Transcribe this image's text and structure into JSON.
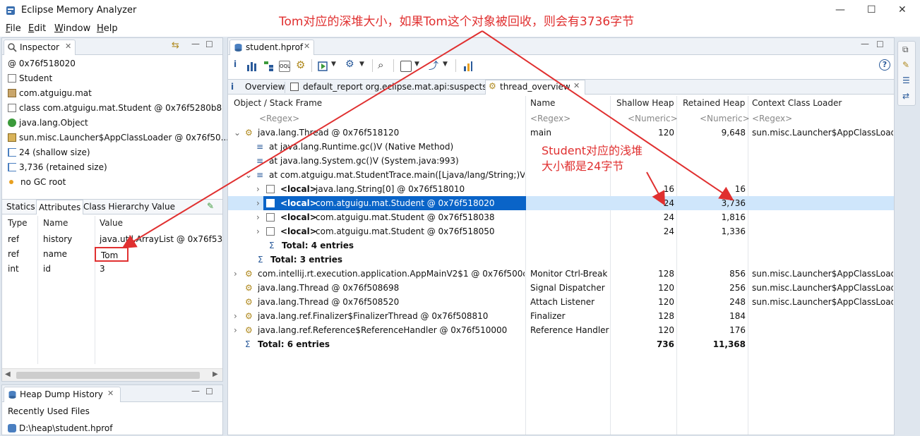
{
  "window": {
    "title": "Eclipse Memory Analyzer"
  },
  "menu": [
    {
      "label": "File",
      "mn": "F",
      "rest": "ile"
    },
    {
      "label": "Edit",
      "mn": "E",
      "rest": "dit"
    },
    {
      "label": "Window",
      "mn": "W",
      "rest": "indow"
    },
    {
      "label": "Help",
      "mn": "H",
      "rest": "elp"
    }
  ],
  "inspector": {
    "tab": "Inspector",
    "items": [
      "0x76f518020",
      "Student",
      "com.atguigu.mat",
      "class com.atguigu.mat.Student @ 0x76f5280b8",
      "java.lang.Object",
      "sun.misc.Launcher$AppClassLoader @ 0x76f50...",
      "24 (shallow size)",
      "3,736 (retained size)",
      "no GC root"
    ],
    "subtabs": [
      "Statics",
      "Attributes",
      "Class Hierarchy",
      "Value"
    ],
    "columns": [
      "Type",
      "Name",
      "Value"
    ],
    "rows": [
      {
        "type": "ref",
        "name": "history",
        "value": "java.util.ArrayList @ 0x76f53a2..."
      },
      {
        "type": "ref",
        "name": "name",
        "value": "Tom"
      },
      {
        "type": "int",
        "name": "id",
        "value": "3"
      }
    ]
  },
  "heap_history": {
    "tab": "Heap Dump History",
    "heading": "Recently Used Files",
    "files": [
      "D:\\heap\\student.hprof"
    ]
  },
  "editor": {
    "tab": "student.hprof",
    "subtabs": [
      "Overview",
      "default_report  org.eclipse.mat.api:suspects",
      "thread_overview"
    ],
    "columns": {
      "frame": "Object / Stack Frame",
      "name": "Name",
      "shallow": "Shallow Heap",
      "retained": "Retained Heap",
      "loader": "Context Class Loader"
    },
    "filters": {
      "frame": "<Regex>",
      "name": "<Regex>",
      "shallow": "<Numeric>",
      "retained": "<Numeric>",
      "loader": "<Regex>"
    },
    "rows": [
      {
        "frame": "java.lang.Thread @ 0x76f518120",
        "name": "main",
        "shallow": "120",
        "retained": "9,648",
        "loader": "sun.misc.Launcher$AppClassLoader"
      },
      {
        "frame": "at java.lang.Runtime.gc()V (Native Method)"
      },
      {
        "frame": "at java.lang.System.gc()V (System.java:993)"
      },
      {
        "frame": "at com.atguigu.mat.StudentTrace.main([Ljava/lang/String;)V (Stu..."
      },
      {
        "local": "<local>",
        "frame": "java.lang.String[0] @ 0x76f518010",
        "shallow": "16",
        "retained": "16"
      },
      {
        "local": "<local>",
        "frame": "com.atguigu.mat.Student @ 0x76f518020",
        "shallow": "24",
        "retained": "3,736"
      },
      {
        "local": "<local>",
        "frame": "com.atguigu.mat.Student @ 0x76f518038",
        "shallow": "24",
        "retained": "1,816"
      },
      {
        "local": "<local>",
        "frame": "com.atguigu.mat.Student @ 0x76f518050",
        "shallow": "24",
        "retained": "1,336"
      },
      {
        "frame": "Total: 4 entries"
      },
      {
        "frame": "Total: 3 entries"
      },
      {
        "frame": "com.intellij.rt.execution.application.AppMainV2$1 @ 0x76f500d00",
        "name": "Monitor Ctrl-Break",
        "shallow": "128",
        "retained": "856",
        "loader": "sun.misc.Launcher$AppClassLoader"
      },
      {
        "frame": "java.lang.Thread @ 0x76f508698",
        "name": "Signal Dispatcher",
        "shallow": "120",
        "retained": "256",
        "loader": "sun.misc.Launcher$AppClassLoader"
      },
      {
        "frame": "java.lang.Thread @ 0x76f508520",
        "name": "Attach Listener",
        "shallow": "120",
        "retained": "248",
        "loader": "sun.misc.Launcher$AppClassLoader"
      },
      {
        "frame": "java.lang.ref.Finalizer$FinalizerThread @ 0x76f508810",
        "name": "Finalizer",
        "shallow": "128",
        "retained": "184"
      },
      {
        "frame": "java.lang.ref.Reference$ReferenceHandler @ 0x76f510000",
        "name": "Reference Handler",
        "shallow": "120",
        "retained": "176"
      },
      {
        "frame": "Total: 6 entries",
        "shallow": "736",
        "retained": "11,368"
      }
    ]
  },
  "annotations": {
    "top": "Tom对应的深堆大小，如果Tom这个对象被回收，则会有3736字节",
    "right_line1": "Student对应的浅堆",
    "right_line2": "大小都是24字节"
  },
  "colors": {
    "accent_red": "#e03030",
    "selection": "#0a64c8",
    "selection_row": "#cfe6fb"
  }
}
